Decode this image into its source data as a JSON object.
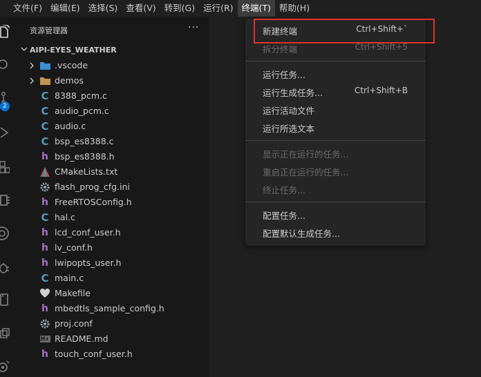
{
  "menubar": {
    "items": [
      {
        "label": "文件(F)"
      },
      {
        "label": "编辑(E)"
      },
      {
        "label": "选择(S)"
      },
      {
        "label": "查看(V)"
      },
      {
        "label": "转到(G)"
      },
      {
        "label": "运行(R)"
      },
      {
        "label": "终端(T)"
      },
      {
        "label": "帮助(H)"
      }
    ],
    "active_index": 6
  },
  "activitybar": {
    "badge_count": "2",
    "icons": [
      "files-icon",
      "search-icon",
      "source-control-icon",
      "run-debug-icon",
      "extensions-icon",
      "chip-icon",
      "remote-icon",
      "bug-icon",
      "book-icon",
      "window-icon",
      "settings-icon"
    ]
  },
  "sidebar": {
    "title": "资源管理器",
    "more": "···",
    "project": "AIPI-EYES_WEATHER",
    "items": [
      {
        "name": ".vscode",
        "type": "folder",
        "icon": "vscode-folder-icon",
        "color": "#3b8fd6"
      },
      {
        "name": "demos",
        "type": "folder",
        "icon": "folder-icon",
        "color": "#c09553"
      },
      {
        "name": "8388_pcm.c",
        "type": "c"
      },
      {
        "name": "audio_pcm.c",
        "type": "c"
      },
      {
        "name": "audio.c",
        "type": "c"
      },
      {
        "name": "bsp_es8388.c",
        "type": "c"
      },
      {
        "name": "bsp_es8388.h",
        "type": "h"
      },
      {
        "name": "CMakeLists.txt",
        "type": "cmake"
      },
      {
        "name": "flash_prog_cfg.ini",
        "type": "gear"
      },
      {
        "name": "FreeRTOSConfig.h",
        "type": "h"
      },
      {
        "name": "hal.c",
        "type": "c"
      },
      {
        "name": "lcd_conf_user.h",
        "type": "h"
      },
      {
        "name": "lv_conf.h",
        "type": "h"
      },
      {
        "name": "lwipopts_user.h",
        "type": "h"
      },
      {
        "name": "main.c",
        "type": "c"
      },
      {
        "name": "Makefile",
        "type": "make"
      },
      {
        "name": "mbedtls_sample_config.h",
        "type": "h"
      },
      {
        "name": "proj.conf",
        "type": "gear"
      },
      {
        "name": "README.md",
        "type": "md"
      },
      {
        "name": "touch_conf_user.h",
        "type": "h"
      }
    ]
  },
  "terminal_menu": {
    "groups": [
      [
        {
          "label": "新建终端",
          "shortcut": "Ctrl+Shift+`",
          "disabled": false
        },
        {
          "label": "拆分终端",
          "shortcut": "Ctrl+Shift+5",
          "disabled": true
        }
      ],
      [
        {
          "label": "运行任务...",
          "shortcut": "",
          "disabled": false
        },
        {
          "label": "运行生成任务...",
          "shortcut": "Ctrl+Shift+B",
          "disabled": false
        },
        {
          "label": "运行活动文件",
          "shortcut": "",
          "disabled": false
        },
        {
          "label": "运行所选文本",
          "shortcut": "",
          "disabled": false
        }
      ],
      [
        {
          "label": "显示正在运行的任务...",
          "shortcut": "",
          "disabled": true
        },
        {
          "label": "重启正在运行的任务...",
          "shortcut": "",
          "disabled": true
        },
        {
          "label": "终止任务...",
          "shortcut": "",
          "disabled": true
        }
      ],
      [
        {
          "label": "配置任务...",
          "shortcut": "",
          "disabled": false
        },
        {
          "label": "配置默认生成任务...",
          "shortcut": "",
          "disabled": false
        }
      ]
    ]
  },
  "colors": {
    "accent": "#0078d4",
    "highlight_box": "#e03131",
    "c_file": "#519aba",
    "h_file": "#a074c4"
  }
}
